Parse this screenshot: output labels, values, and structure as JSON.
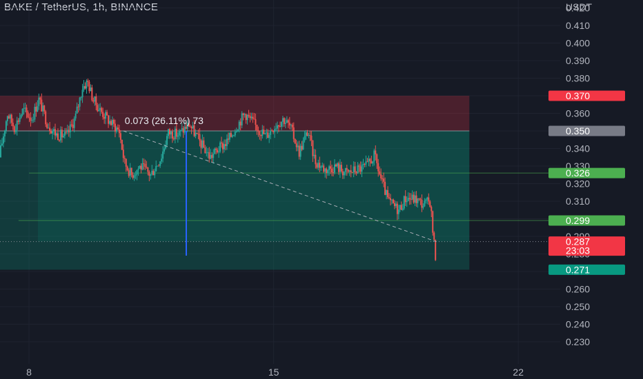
{
  "header": {
    "title": "BAKE / TetherUS, 1h, BINANCE"
  },
  "chart_data": {
    "type": "candlestick",
    "symbol": "BAKE / TetherUS",
    "interval": "1h",
    "exchange": "BINANCE",
    "y_axis": {
      "unit": "USDT",
      "ylim": [
        0.2245,
        0.4245
      ],
      "ticks": [
        0.42,
        0.41,
        0.4,
        0.39,
        0.38,
        0.37,
        0.36,
        0.35,
        0.34,
        0.33,
        0.32,
        0.31,
        0.3,
        0.29,
        0.28,
        0.27,
        0.26,
        0.25,
        0.24,
        0.23
      ],
      "tick_labels": [
        "0.420",
        "0.410",
        "0.400",
        "0.390",
        "0.380",
        "0.370",
        "0.360",
        "0.350",
        "0.340",
        "0.330",
        "0.320",
        "0.310",
        "0.300",
        "0.290",
        "0.280",
        "0.270",
        "0.260",
        "0.250",
        "0.240",
        "0.230"
      ]
    },
    "x_axis": {
      "range_days": [
        7.17,
        23.2
      ],
      "ticks": [
        8,
        15,
        22
      ],
      "tick_labels": [
        "8",
        "15",
        "22"
      ]
    },
    "grid": true,
    "price_path": [
      [
        7.17,
        0.335
      ],
      [
        7.4,
        0.36
      ],
      [
        7.6,
        0.352
      ],
      [
        7.85,
        0.362
      ],
      [
        8.1,
        0.357
      ],
      [
        8.3,
        0.368
      ],
      [
        8.55,
        0.354
      ],
      [
        8.8,
        0.348
      ],
      [
        9.1,
        0.347
      ],
      [
        9.35,
        0.358
      ],
      [
        9.55,
        0.375
      ],
      [
        9.7,
        0.378
      ],
      [
        9.85,
        0.368
      ],
      [
        10.05,
        0.362
      ],
      [
        10.3,
        0.356
      ],
      [
        10.6,
        0.35
      ],
      [
        10.75,
        0.332
      ],
      [
        10.95,
        0.325
      ],
      [
        11.2,
        0.33
      ],
      [
        11.5,
        0.325
      ],
      [
        11.8,
        0.335
      ],
      [
        12.0,
        0.349
      ],
      [
        12.3,
        0.348
      ],
      [
        12.6,
        0.354
      ],
      [
        12.9,
        0.344
      ],
      [
        13.2,
        0.335
      ],
      [
        13.4,
        0.339
      ],
      [
        13.7,
        0.344
      ],
      [
        14.0,
        0.354
      ],
      [
        14.2,
        0.36
      ],
      [
        14.5,
        0.353
      ],
      [
        14.8,
        0.347
      ],
      [
        15.0,
        0.352
      ],
      [
        15.3,
        0.357
      ],
      [
        15.5,
        0.352
      ],
      [
        15.75,
        0.338
      ],
      [
        16.0,
        0.35
      ],
      [
        16.2,
        0.333
      ],
      [
        16.5,
        0.328
      ],
      [
        16.8,
        0.33
      ],
      [
        17.1,
        0.326
      ],
      [
        17.4,
        0.328
      ],
      [
        17.7,
        0.33
      ],
      [
        17.9,
        0.336
      ],
      [
        18.1,
        0.322
      ],
      [
        18.3,
        0.31
      ],
      [
        18.6,
        0.305
      ],
      [
        18.8,
        0.312
      ],
      [
        19.1,
        0.311
      ],
      [
        19.3,
        0.308
      ],
      [
        19.5,
        0.31
      ],
      [
        19.6,
        0.287
      ],
      [
        19.65,
        0.279
      ]
    ],
    "current_price": {
      "value": 0.287,
      "label": "0.287",
      "countdown": "23:03",
      "color": "#f23645"
    },
    "position_tool": {
      "x_start": 7.17,
      "x_end": 20.6,
      "stop": 0.37,
      "entry": 0.35,
      "target": 0.271,
      "stop_color": "#f23645",
      "target_color": "#089981"
    },
    "horizontal_lines": [
      {
        "value": 0.326,
        "label": "0.326",
        "x_from": 8.0
      },
      {
        "value": 0.299,
        "label": "0.299",
        "x_from": 7.7
      }
    ],
    "price_labels": [
      {
        "value": 0.37,
        "label": "0.370",
        "color": "#f23645"
      },
      {
        "value": 0.35,
        "label": "0.350",
        "color": "#787b86"
      },
      {
        "value": 0.326,
        "label": "0.326",
        "color": "#4caf50"
      },
      {
        "value": 0.299,
        "label": "0.299",
        "color": "#4caf50"
      },
      {
        "value": 0.271,
        "label": "0.271",
        "color": "#089981"
      }
    ],
    "measure": {
      "label": "0.073 (26.11%) 73",
      "from": [
        10.7,
        0.35
      ],
      "to": [
        19.65,
        0.287
      ]
    },
    "vertical_marker": {
      "x": 12.5,
      "top": 0.35,
      "bottom": 0.279,
      "color": "#2962ff"
    },
    "colors": {
      "up": "#26a69a",
      "down": "#ef5350",
      "background": "#161a25",
      "grid": "#1f2330"
    }
  }
}
